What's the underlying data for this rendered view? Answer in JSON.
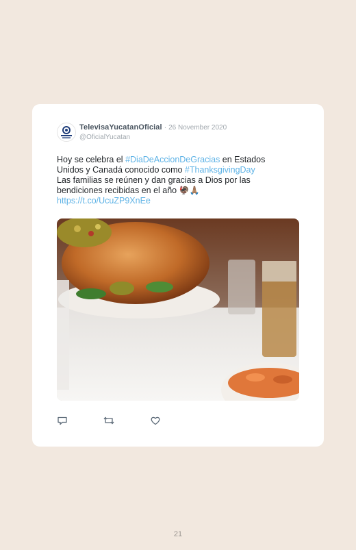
{
  "tweet": {
    "author_name": "TelevisaYucatanOficial",
    "separator": "·",
    "date": "26 November 2020",
    "handle": "@OficialYucatan",
    "text_1": "Hoy se celebra el ",
    "hashtag_1": "#DiaDeAccionDeGracias",
    "text_2": " en Estados Unidos y Canadá conocido como ",
    "hashtag_2": "#ThanksgivingDay",
    "text_3": "Las familias se reúnen y dan gracias a Dios por las bendiciones recibidas en el año ",
    "emoji": "🦃🙏🏽",
    "link": "https://t.co/UcuZP9XnEe",
    "avatar_caption": "Televisa",
    "icons": [
      "reply-icon",
      "retweet-icon",
      "like-icon"
    ]
  },
  "page": {
    "number": "21"
  },
  "colors": {
    "background": "#f2e8df",
    "card": "#ffffff",
    "accent": "#5fb3e6",
    "author": "#4a5560",
    "muted": "#a0a7ad"
  }
}
